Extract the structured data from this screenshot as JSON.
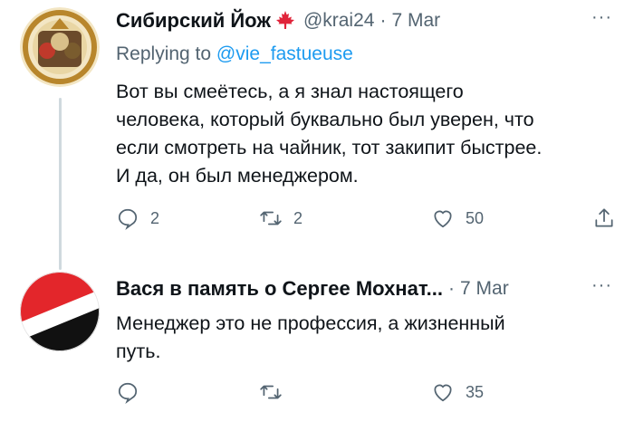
{
  "tweets": [
    {
      "author_name": "Сибирский Йож",
      "handle": "@krai24",
      "date": "7 Mar",
      "replying_prefix": "Replying to",
      "replying_handle": "@vie_fastueuse",
      "text": "Вот вы смеётесь, а я знал настоящего\nчеловека, который буквально был уверен, что\nесли смотреть на чайник, тот закипит быстрее.\nИ да, он был менеджером.",
      "replies": "2",
      "retweets": "2",
      "likes": "50"
    },
    {
      "author_name": "Вася в память о Сергее Мохнат...",
      "date": "7 Mar",
      "text": "Менеджер это не профессия, а жизненный\nпуть.",
      "likes": "35"
    }
  ],
  "ui": {
    "more_label": "···",
    "separator": "·"
  },
  "colors": {
    "text": "#0f1419",
    "secondary": "#536471",
    "link": "#1d9bf0",
    "maple_leaf": "#e0243a"
  }
}
